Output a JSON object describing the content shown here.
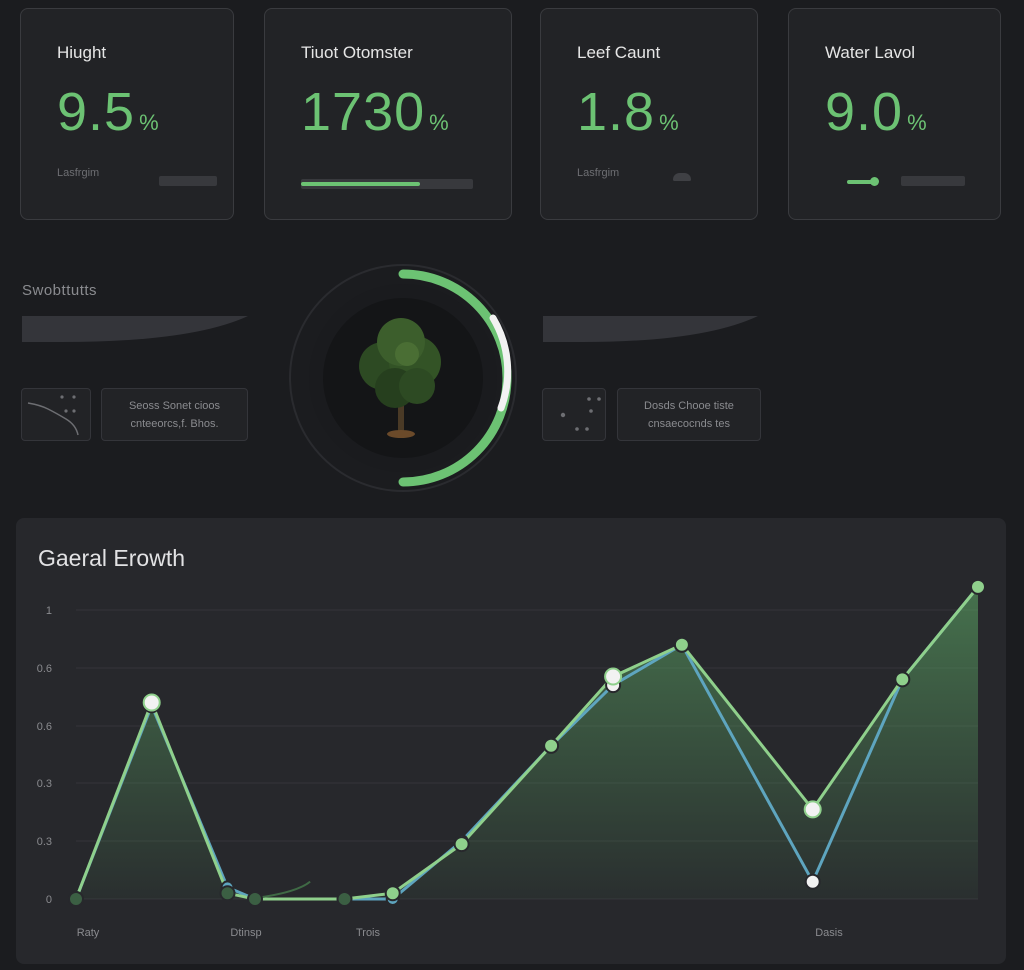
{
  "cards": [
    {
      "title": "Hiught",
      "value": "9.5",
      "unit": "%",
      "sub": "Lasfrgim",
      "progress": 0
    },
    {
      "title": "Tiuot Otomster",
      "value": "1730",
      "unit": "%",
      "sub": "",
      "progress": 0.69
    },
    {
      "title": "Leef Caunt",
      "value": "1.8",
      "unit": "%",
      "sub": "Lasfrgim",
      "progress": 0
    },
    {
      "title": "Water Lavol",
      "value": "9.0",
      "unit": "%",
      "sub": "",
      "progress": 0.21
    }
  ],
  "section": {
    "title": "Swobttutts"
  },
  "panels": [
    {
      "line1": "Seoss Sonet cioos",
      "line2": "cnteeorcs,f. Bhos."
    },
    {
      "line1": "Dosds Chooe tiste",
      "line2": "cnsaecocnds tes"
    }
  ],
  "gauge": {
    "progress": 0.5,
    "image": "tree-illustration"
  },
  "colors": {
    "accent": "#6cc273",
    "accent_light": "#8fd08c",
    "blue": "#5ea5bf",
    "background": "#1b1c1f",
    "card": "#222326"
  },
  "chart_data": {
    "type": "line",
    "title": "Gaeral Erowth",
    "y_ticks": [
      "1",
      "0.6",
      "0.6",
      "0.3",
      "0.3",
      "0"
    ],
    "x_tick_labels": [
      "Raty",
      "Dtinsp",
      "Trois",
      "Dasis"
    ],
    "ylim": [
      0,
      1
    ],
    "series": [
      {
        "values": [
          {
            "x": 0,
            "y": 0
          },
          {
            "x": 0.11,
            "y": 0.68
          },
          {
            "x": 0.22,
            "y": 0.02
          },
          {
            "x": 0.26,
            "y": 0
          },
          {
            "x": 0.39,
            "y": 0
          },
          {
            "x": 0.46,
            "y": 0.02
          },
          {
            "x": 0.56,
            "y": 0.19
          },
          {
            "x": 0.69,
            "y": 0.53
          },
          {
            "x": 0.78,
            "y": 0.77
          },
          {
            "x": 0.88,
            "y": 0.88
          },
          {
            "x": 1.07,
            "y": 0.31
          },
          {
            "x": 1.2,
            "y": 0.76
          },
          {
            "x": 1.31,
            "y": 1.08
          }
        ]
      },
      {
        "values": [
          {
            "x": 0,
            "y": 0
          },
          {
            "x": 0.11,
            "y": 0.67
          },
          {
            "x": 0.22,
            "y": 0.04
          },
          {
            "x": 0.26,
            "y": 0
          },
          {
            "x": 0.39,
            "y": 0
          },
          {
            "x": 0.46,
            "y": 0
          },
          {
            "x": 0.56,
            "y": 0.2
          },
          {
            "x": 0.69,
            "y": 0.53
          },
          {
            "x": 0.78,
            "y": 0.74
          },
          {
            "x": 0.88,
            "y": 0.88
          },
          {
            "x": 1.07,
            "y": 0.06
          },
          {
            "x": 1.2,
            "y": 0.76
          },
          {
            "x": 1.31,
            "y": 1.08
          }
        ]
      }
    ]
  }
}
